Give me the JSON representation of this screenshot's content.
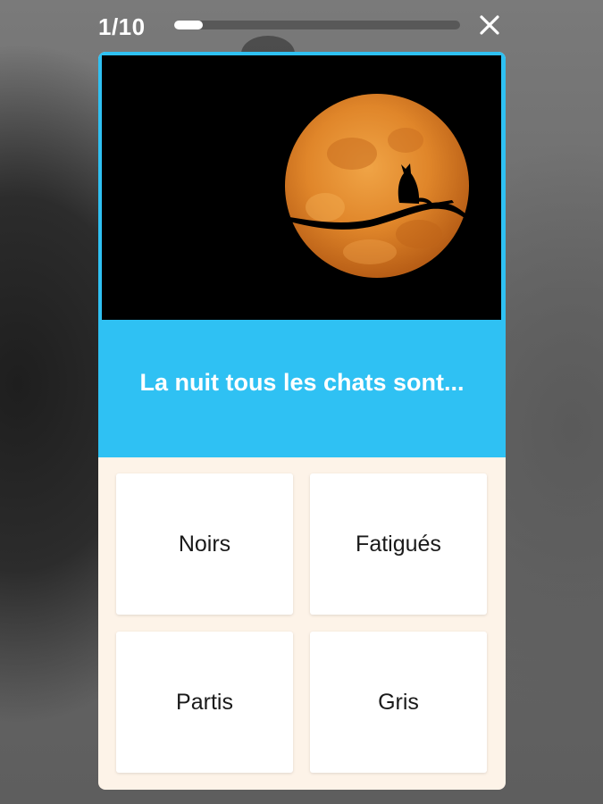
{
  "quiz": {
    "counter": "1/10",
    "progress_fraction": 0.1,
    "close_icon": "close-icon",
    "question": "La nuit tous les chats sont...",
    "image_icon": "moon-cat-silhouette",
    "answers": [
      {
        "label": "Noirs"
      },
      {
        "label": "Fatigués"
      },
      {
        "label": "Partis"
      },
      {
        "label": "Gris"
      }
    ]
  },
  "colors": {
    "accent": "#2fc1f3",
    "card_bg": "#fdf3e8",
    "moon": "#e08a2e"
  }
}
